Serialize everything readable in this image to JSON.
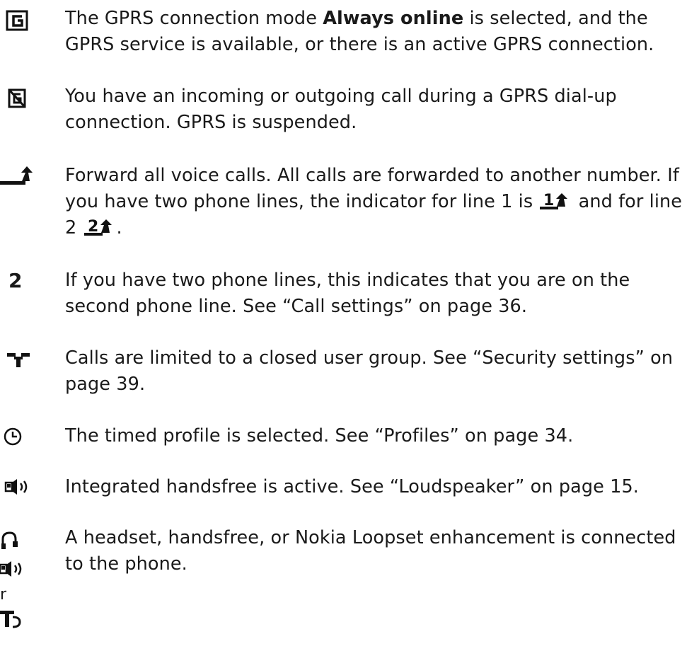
{
  "entries": [
    {
      "icon": "gprs-always-online-icon",
      "text_before": "The GPRS connection mode ",
      "bold": "Always online",
      "text_after": " is selected, and the GPRS service is available, or there is an active GPRS connection."
    },
    {
      "icon": "gprs-suspended-icon",
      "text": "You have an incoming or outgoing call during a GPRS dial-up connection. GPRS is suspended."
    },
    {
      "icon": "call-forward-icon",
      "text_part1": "Forward all voice calls. All calls are forwarded to another number. If you have two phone lines, the indicator for line 1 is ",
      "text_part2": " and for line 2 ",
      "text_part3": ".",
      "line1_glyph": "1",
      "line2_glyph": "2"
    },
    {
      "icon": "second-phone-line-icon",
      "glyph": "2",
      "text": "If you have two phone lines, this indicates that you are on the second phone line. See “Call settings” on page 36."
    },
    {
      "icon": "closed-user-group-icon",
      "text": "Calls are limited to a closed user group. See “Security settings” on page 39."
    },
    {
      "icon": "timed-profile-icon",
      "text": "The timed profile is selected. See “Profiles” on page 34."
    },
    {
      "icon": "loudspeaker-icon",
      "text": "Integrated handsfree is active. See “Loudspeaker” on page 15."
    },
    {
      "icon": "headset-icon",
      "text": "A headset, handsfree, or Nokia Loopset enhancement is connected to the phone.",
      "or_label": "r"
    }
  ]
}
